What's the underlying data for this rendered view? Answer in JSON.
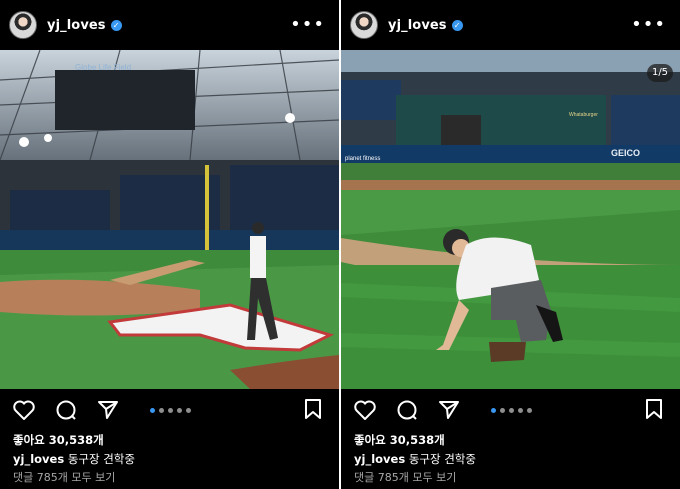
{
  "posts": [
    {
      "username": "yj_loves",
      "likes": "좋아요 30,538개",
      "caption_user": "yj_loves",
      "caption_text": "동구장 견학중",
      "comments": "댓글 785개 모두 보기",
      "carousel_index": 1,
      "carousel_count": 5,
      "counter": "",
      "stadium_banner": "Globe Life Field"
    },
    {
      "username": "yj_loves",
      "likes": "좋아요 30,538개",
      "caption_user": "yj_loves",
      "caption_text": "동구장 견학중",
      "comments": "댓글 785개 모두 보기",
      "carousel_index": 1,
      "carousel_count": 5,
      "counter": "1/5",
      "sign_1": "planet fitness",
      "sign_2": "GEICO",
      "sign_3": "Whataburger"
    }
  ],
  "colors": {
    "verified": "#3897f0",
    "field_green": "#3e8c3b",
    "dirt": "#b7805a"
  },
  "icons": [
    "more-icon",
    "heart-icon",
    "comment-icon",
    "share-icon",
    "save-icon",
    "verified-icon"
  ]
}
